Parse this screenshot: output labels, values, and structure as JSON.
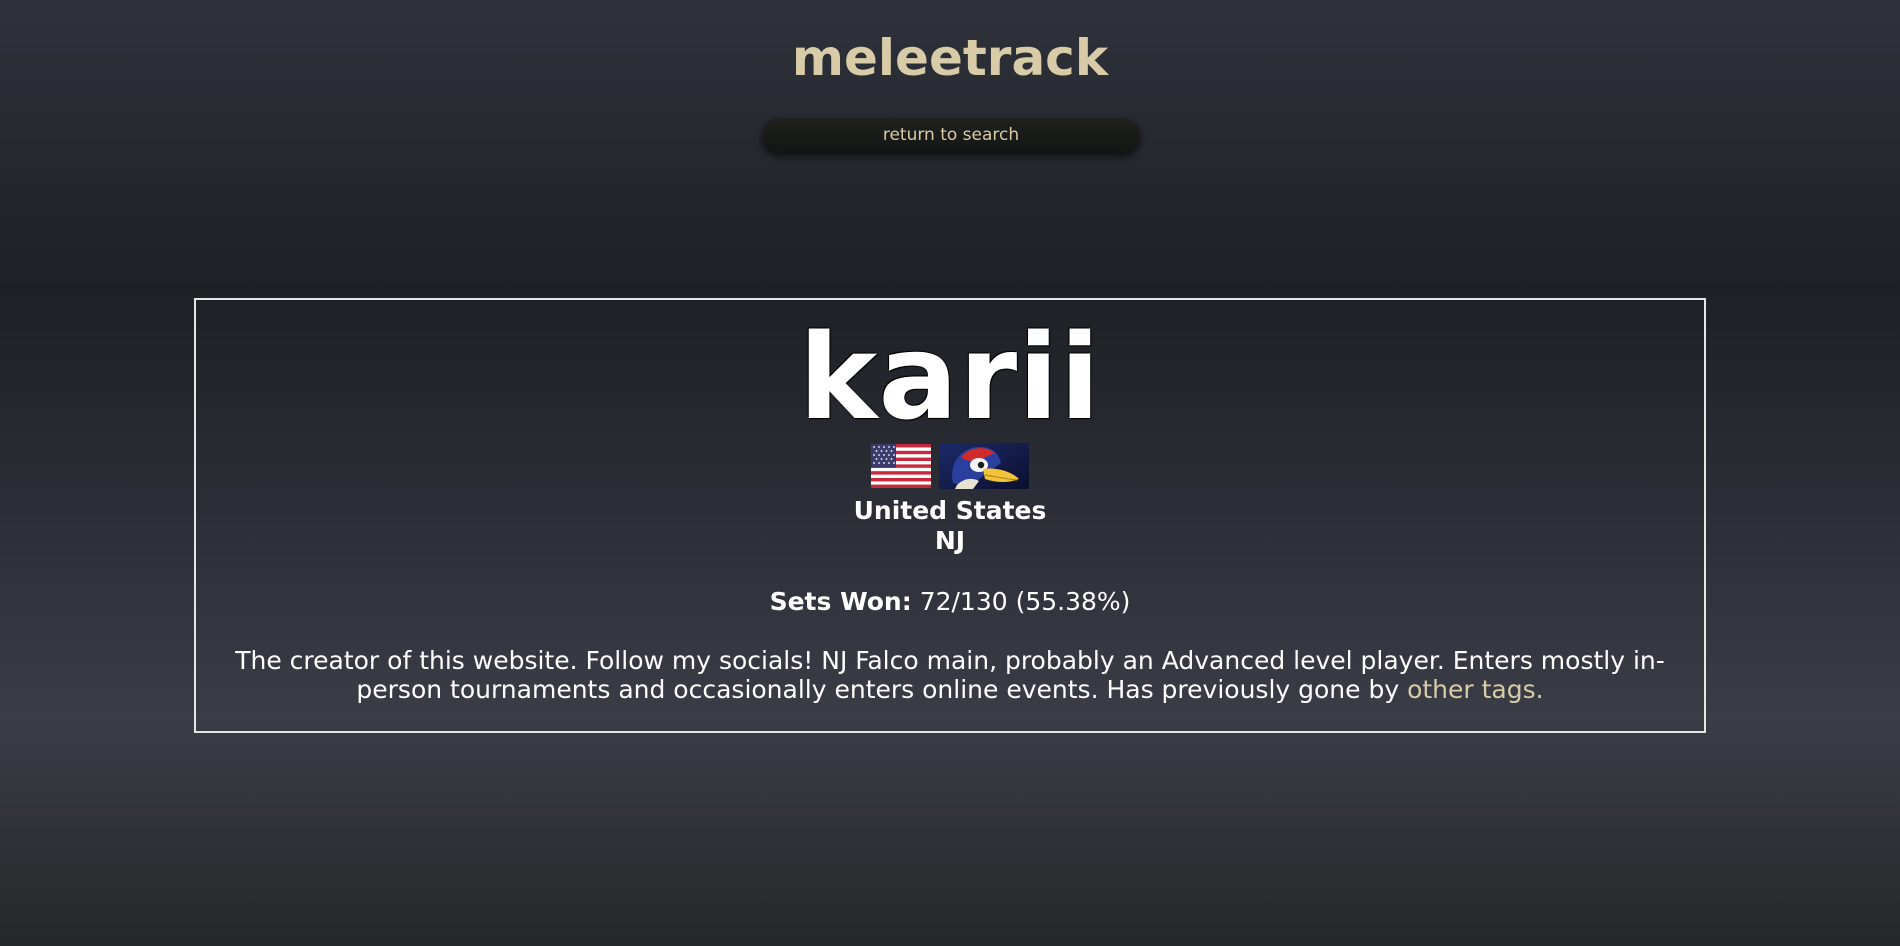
{
  "header": {
    "site_title": "meleetrack",
    "return_button_label": "return to search"
  },
  "player": {
    "tag": "karii",
    "country": "United States",
    "region": "NJ",
    "flag_icon": "us-flag-icon",
    "character_icon": "falco-icon",
    "sets_won_label": "Sets Won:",
    "sets_won_value": "72/130 (55.38%)",
    "sets_won_fraction": 0.5538,
    "bio_text": "The creator of this website. Follow my socials! NJ Falco main, probably an Advanced level player. Enters mostly in-person tournaments and occasionally enters online events. Has previously gone by ",
    "bio_link_text": "other tags."
  },
  "colors": {
    "accent": "#d7cba8",
    "text": "#ffffff",
    "card_border": "#e6e6e6"
  }
}
